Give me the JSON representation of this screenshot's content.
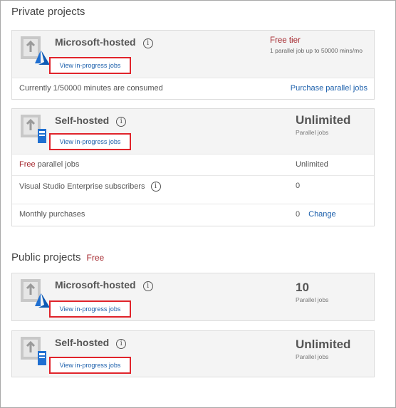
{
  "private": {
    "title": "Private projects",
    "ms_hosted": {
      "name": "Microsoft-hosted",
      "link": "View in-progress jobs",
      "tier_title": "Free tier",
      "tier_desc": "1 parallel job up to 50000 mins/mo",
      "usage": "Currently 1/50000 minutes are consumed",
      "purchase": "Purchase parallel jobs"
    },
    "self_hosted": {
      "name": "Self-hosted",
      "link": "View in-progress jobs",
      "big": "Unlimited",
      "sub": "Parallel jobs",
      "rows": [
        {
          "free_word": "Free",
          "label_rest": " parallel jobs",
          "value": "Unlimited"
        },
        {
          "label": "Visual Studio Enterprise subscribers",
          "value": "0"
        },
        {
          "label": "Monthly purchases",
          "value": "0",
          "action": "Change"
        }
      ]
    }
  },
  "public": {
    "title": "Public projects",
    "tag": "Free",
    "ms_hosted": {
      "name": "Microsoft-hosted",
      "link": "View in-progress jobs",
      "big": "10",
      "sub": "Parallel jobs"
    },
    "self_hosted": {
      "name": "Self-hosted",
      "link": "View in-progress jobs",
      "big": "Unlimited",
      "sub": "Parallel jobs"
    }
  },
  "icons": {
    "info": "info-icon",
    "azure": "azure-icon",
    "agent": "agent-icon",
    "build": "build-icon"
  },
  "colors": {
    "link": "#1b5fab",
    "free": "#a4262c",
    "highlight": "#e0242b",
    "card_head": "#f4f4f4"
  }
}
